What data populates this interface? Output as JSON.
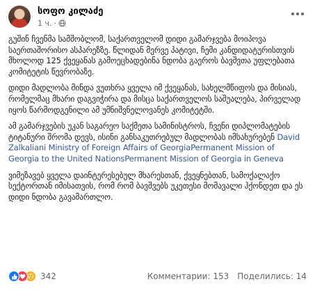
{
  "post": {
    "author": "სოფო კილაძე",
    "time": "1 ч.",
    "paragraphs": [
      "გუშინ ჩვენმა სამშობლომ, საქართველომ დიდი გამარჯვება მოიპოვა საერთაშორისო ასპარეზზე. წლიდან მერვე პატივი, ჩემი კანდიდატურისთვის მხოლოდ 125 ქვეყანას გამოეცხადებინა ნდობა გაეროს ბავშვთა უფლებათა კომიტეტის წევრობაზე.",
      "დიდი მადლობა მინდა ვუთხრა ყველა იმ ქვეყანას, სახელმწიფოს და მისიას, რომელმაც მხარი დაგვიჭირა და მისცა საქართველოს საშუალება, პირველად იყოს წარმოდგენილი ამ უმნიშვნელოვანეს კომიტეტში.",
      "ამ გამარჯვების უკან საგარეო საქმეთა სამინისტროს, ჩვენი დიპლომატების ტიტანური შრომა დევს, ისინი განსაკუთრებულ მადლობას იმსახურებენ"
    ],
    "mentions": [
      "David Zalkaliani",
      "Ministry of Foreign Affairs of Georgia",
      "Permanent Mission of Georgia to the United Nations",
      "Permanent  Mission of Georgia in Geneva"
    ],
    "closing": "ვიმეზავებ ყველა დაინტერესებულ მხარესთან, ქვეყნებთან, სამოქალაქო სექტორთან იმისათვის, რომ რომ ბავშვებს უკეთესი მომავალი ჰქონდეთ და ეს დიდი ნდობა გავამართლო.",
    "reactions": {
      "types": [
        "like-icon",
        "love-icon",
        "care-icon"
      ],
      "count": "342"
    },
    "comments": "Комментарии: 153",
    "shares": "Поделились: 14"
  }
}
